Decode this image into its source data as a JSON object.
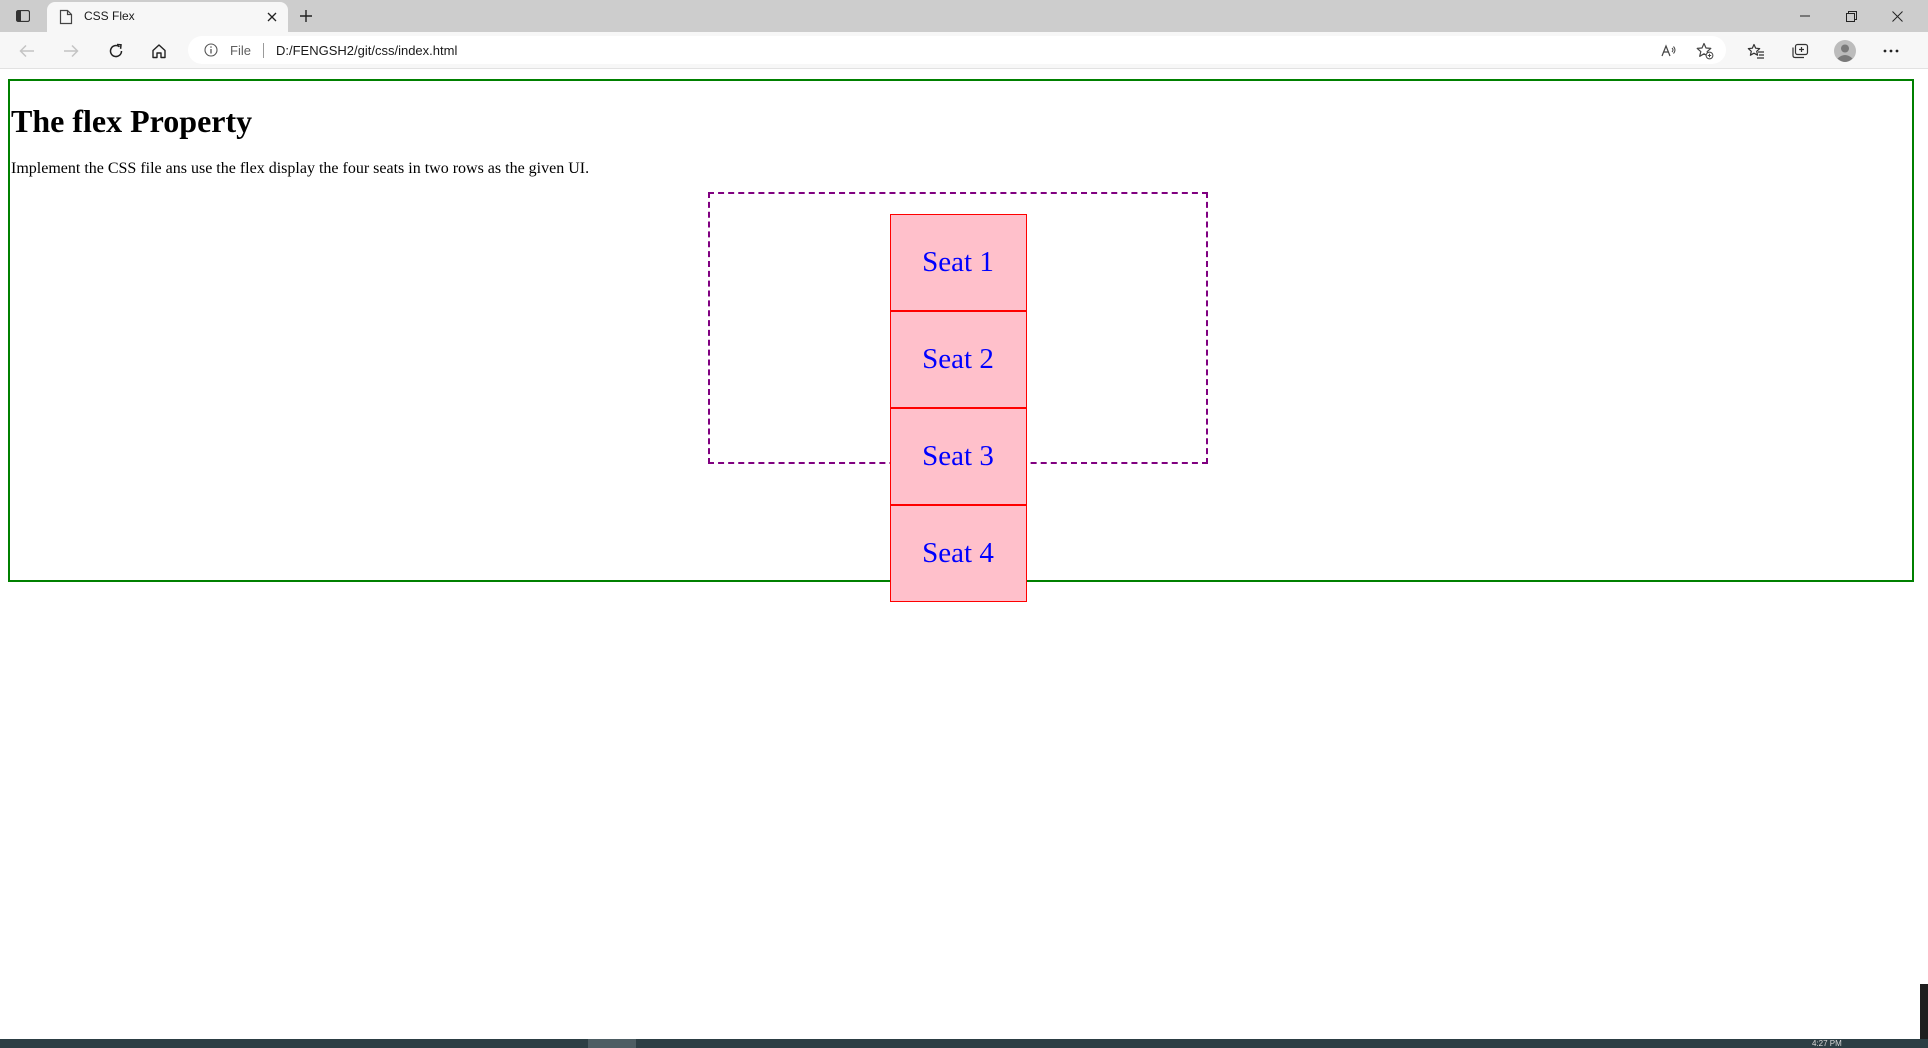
{
  "browser": {
    "tab": {
      "title": "CSS Flex",
      "favicon_icon": "page-icon",
      "close_icon": "close-icon"
    },
    "new_tab_icon": "plus-icon",
    "window_controls": [
      "minimize-icon",
      "restore-icon",
      "close-icon"
    ],
    "toolbar": {
      "back_icon": "arrow-left-icon",
      "forward_icon": "arrow-right-icon",
      "reload_icon": "reload-icon",
      "home_icon": "home-icon",
      "address": {
        "info_icon": "info-icon",
        "scheme_label": "File",
        "url": "D:/FENGSH2/git/css/index.html"
      },
      "read_aloud_icon": "read-aloud-icon",
      "add_favorite_icon": "star-add-icon",
      "favorites_icon": "favorites-icon",
      "collections_icon": "collections-icon",
      "profile_icon": "avatar-icon",
      "menu_icon": "more-icon"
    }
  },
  "page": {
    "heading": "The flex Property",
    "description": "Implement the CSS file ans use the flex display the four seats in two rows as the given UI.",
    "seats": [
      "Seat 1",
      "Seat 2",
      "Seat 3",
      "Seat 4"
    ]
  },
  "taskbar": {
    "clock": "4:27 PM"
  },
  "colors": {
    "outer_border": "#008000",
    "container_border": "#800080",
    "seat_background": "#ffc0cb",
    "seat_border": "#ff0000",
    "seat_text": "#0000ff"
  }
}
